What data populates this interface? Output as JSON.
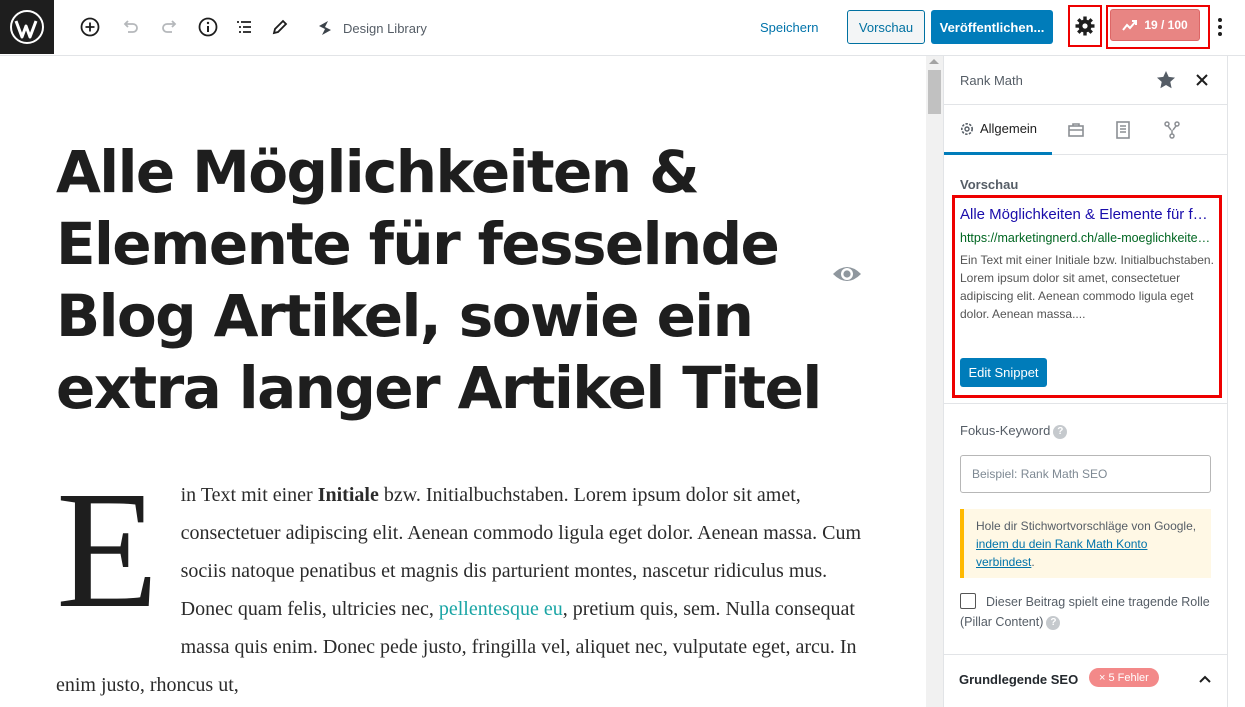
{
  "toolbar": {
    "design_library": "Design Library",
    "save": "Speichern",
    "preview": "Vorschau",
    "publish": "Veröffentlichen...",
    "score": "19 / 100"
  },
  "post": {
    "title": "Alle Möglichkeiten & Elemente für fesselnde Blog Artikel, sowie ein extra langer Artikel Titel",
    "dropcap": "E",
    "body_1": "in Text mit einer ",
    "body_bold": "Initiale",
    "body_2": " bzw. Initialbuchstaben. Lorem ipsum dolor sit amet, consectetuer adipiscing elit. Aenean commodo ligula eget dolor. Aenean massa. Cum sociis natoque penatibus et magnis dis parturient montes, nascetur ridiculus mus. Donec quam felis, ultricies nec, ",
    "body_link": "pellentesque eu",
    "body_3": ", pretium quis, sem. Nulla consequat massa quis enim. Donec pede justo, fringilla vel, aliquet nec, vulputate eget, arcu. In enim justo, rhoncus ut,"
  },
  "sidebar": {
    "title": "Rank Math",
    "tab_general": "Allgemein",
    "preview_label": "Vorschau",
    "snippet": {
      "title": "Alle Möglichkeiten & Elemente für fesselnde Blog Artikel",
      "url": "https://marketingnerd.ch/alle-moeglichkeiten-elemente",
      "description": "Ein Text mit einer Initiale bzw. Initialbuchstaben. Lorem ipsum dolor sit amet, consectetuer adipiscing elit. Aenean commodo ligula eget dolor. Aenean massa....",
      "edit_button": "Edit Snippet"
    },
    "focus_keyword_label": "Fokus-Keyword",
    "focus_keyword_placeholder": "Beispiel: Rank Math SEO",
    "notice_1": "Hole dir Stichwortvorschläge von Google, ",
    "notice_link": "indem du dein Rank Math Konto verbindest",
    "notice_2": ".",
    "pillar_label": "Dieser Beitrag spielt eine tragende Rolle (Pillar Content)",
    "basic_seo": "Grundlegende SEO",
    "errors_badge": "× 5 Fehler"
  },
  "colors": {
    "accent": "#007cba",
    "score": "#e88583",
    "highlight": "#ee0000"
  }
}
